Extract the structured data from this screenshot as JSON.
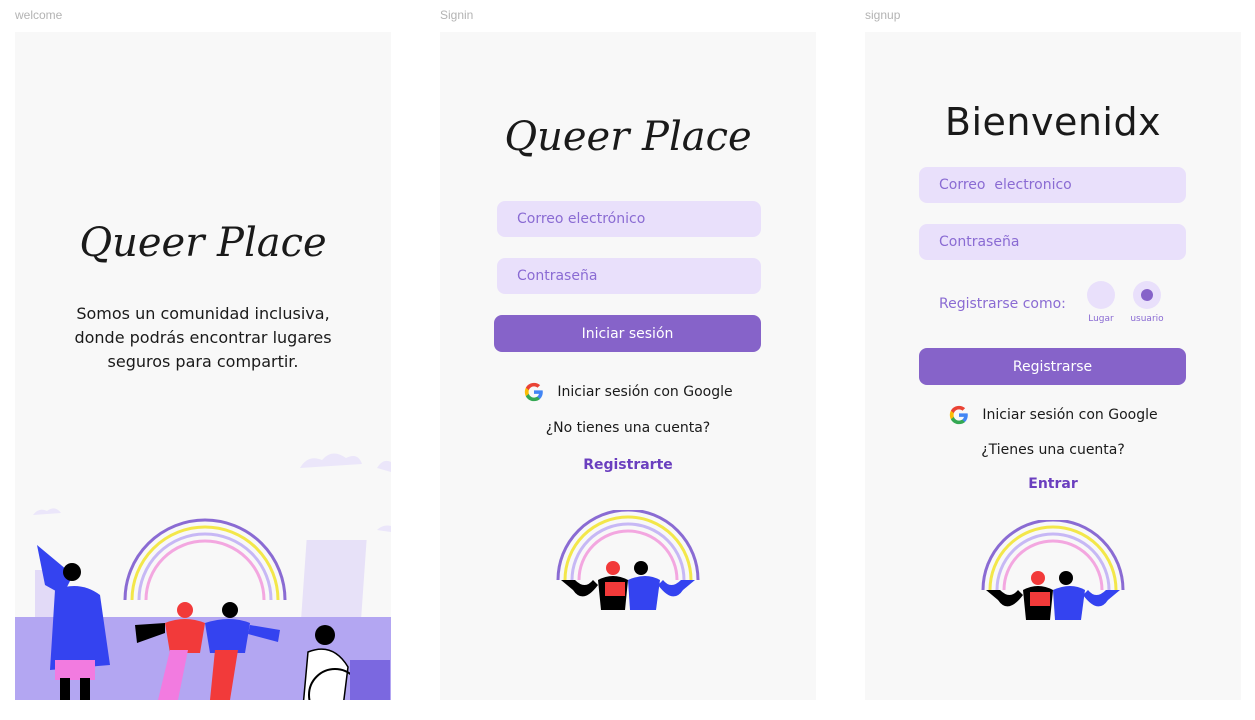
{
  "frames": {
    "welcome": {
      "label": "welcome",
      "logo": "Queer Place",
      "tagline": "Somos un comunidad inclusiva, donde podrás encontrar lugares seguros para compartir."
    },
    "signin": {
      "label": "Signin",
      "logo": "Queer Place",
      "email_placeholder": "Correo electrónico",
      "password_placeholder": "Contraseña",
      "login_button": "Iniciar sesión",
      "google_button": "Iniciar sesión con Google",
      "no_account": "¿No tienes una cuenta?",
      "register_link": "Registrarte"
    },
    "signup": {
      "label": "signup",
      "title": "Bienvenidx",
      "email_placeholder": "Correo  electronico",
      "password_placeholder": "Contraseña",
      "role_label": "Registrarse como:",
      "role_options": [
        "Lugar",
        "usuario"
      ],
      "selected_role": "usuario",
      "register_button": "Registrarse",
      "google_button": "Iniciar sesión con Google",
      "have_account": "¿Tienes una cuenta?",
      "login_link": "Entrar"
    }
  },
  "colors": {
    "accent": "#8663c9",
    "input_bg": "#e9e0fb",
    "placeholder": "#8a6bd3",
    "link": "#6b3fbf"
  }
}
